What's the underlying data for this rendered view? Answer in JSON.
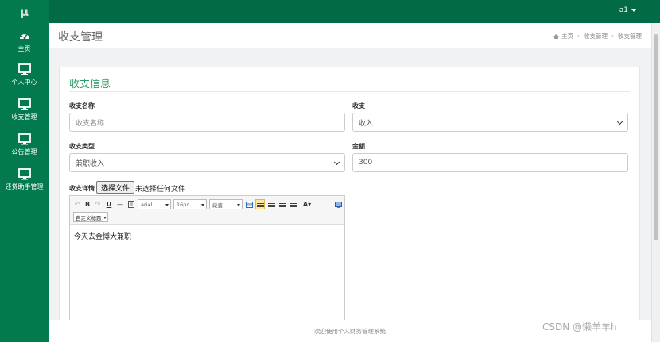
{
  "app": {
    "logo": "μ",
    "user": "a1"
  },
  "sidebar": {
    "items": [
      {
        "label": "主页",
        "icon": "dashboard-icon"
      },
      {
        "label": "个人中心",
        "icon": "monitor-icon"
      },
      {
        "label": "收支管理",
        "icon": "monitor-icon"
      },
      {
        "label": "公告管理",
        "icon": "monitor-icon"
      },
      {
        "label": "还贷助手管理",
        "icon": "monitor-icon"
      }
    ]
  },
  "header": {
    "title": "收支管理",
    "breadcrumb": [
      "主页",
      "收支管理",
      "收支管理"
    ]
  },
  "form": {
    "title": "收支信息",
    "name_label": "收支名称",
    "name_placeholder": "收支名称",
    "type_label": "收支",
    "type_value": "收入",
    "category_label": "收支类型",
    "category_value": "兼职收入",
    "amount_label": "金额",
    "amount_value": "300",
    "detail_label": "收支详情",
    "file_button": "选择文件",
    "file_status": "未选择任何文件"
  },
  "editor": {
    "font_family": "arial",
    "font_size": "16px",
    "paragraph": "段落",
    "custom_title": "自定义标题",
    "content": "今天去金博大兼职"
  },
  "footer": {
    "text": "欢迎使用个人财务管理系统"
  },
  "watermark": "CSDN @懒羊羊h",
  "colors": {
    "sidebar": "#027a4e",
    "topbar": "#026b45",
    "accent": "#2e9d6a"
  }
}
